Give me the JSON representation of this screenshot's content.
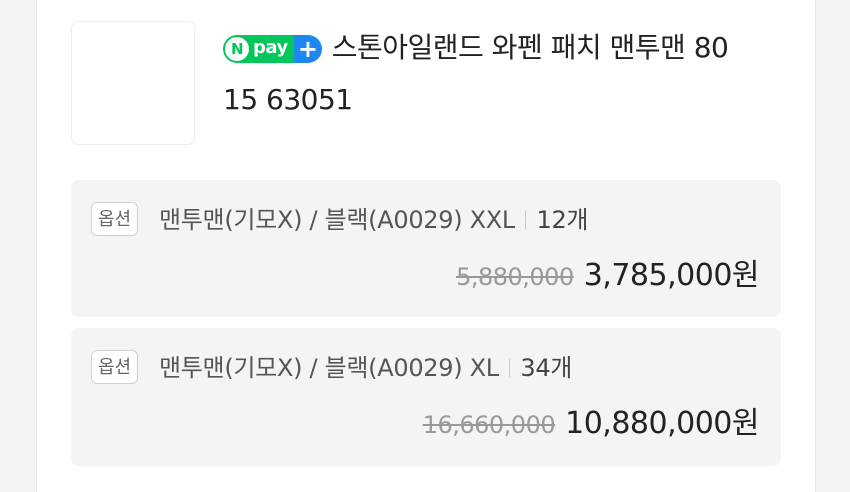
{
  "product": {
    "title_line1": "스톤아일랜드 와펜 패치 맨투맨 80",
    "title_line2": "15 63051",
    "pay_badge": {
      "n": "N",
      "label": "pay",
      "plus": "+"
    }
  },
  "options": [
    {
      "badge": "옵션",
      "name": "맨투맨(기모X) / 블랙(A0029) XXL",
      "quantity": "12개",
      "original_price": "5,880,000",
      "final_price": "3,785,000원"
    },
    {
      "badge": "옵션",
      "name": "맨투맨(기모X) / 블랙(A0029) XL",
      "quantity": "34개",
      "original_price": "16,660,000",
      "final_price": "10,880,000원"
    }
  ],
  "colors": {
    "npay_green": "#03c75a",
    "npay_blue": "#1e88f0",
    "option_bg": "#f3f4f6"
  }
}
